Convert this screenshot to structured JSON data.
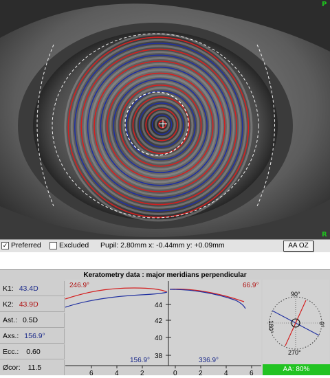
{
  "eye_view": {
    "corner_top_right": "P",
    "corner_bottom_right": "R"
  },
  "toolbar": {
    "preferred_label": "Preferred",
    "preferred_checked": true,
    "excluded_label": "Excluded",
    "excluded_checked": false,
    "pupil_info": "Pupil: 2.80mm x: -0.44mm y: +0.09mm",
    "aa_oz_label": "AA OZ"
  },
  "keratometry": {
    "title": "Keratometry data : major meridians perpendicular",
    "rows": [
      {
        "label": "K1:",
        "value": "43.4D",
        "color": "#1b2a8a"
      },
      {
        "label": "K2:",
        "value": "43.9D",
        "color": "#b01010"
      },
      {
        "label": "Ast.:",
        "value": "0.5D",
        "color": "#000000"
      },
      {
        "label": "Axs.:",
        "value": "156.9°",
        "color": "#1b2a8a"
      },
      {
        "label": "Ecc.:",
        "value": "0.60",
        "color": "#000000"
      },
      {
        "label": "Øcor:",
        "value": "11.5",
        "color": "#000000"
      }
    ],
    "graph": {
      "left_red_axis": "246.9°",
      "right_red_axis": "66.9°",
      "left_blue_axis": "156.9°",
      "right_blue_axis": "336.9°",
      "y_ticks": [
        "44",
        "42",
        "40",
        "38"
      ],
      "x_ticks_left": [
        "6",
        "4",
        "2"
      ],
      "x_ticks_right": [
        "0",
        "2",
        "4",
        "6"
      ]
    },
    "polar": {
      "top": "90°",
      "bottom": "270°",
      "left": "180°",
      "right": "0°"
    },
    "aa_status": "AA: 80%"
  },
  "colors": {
    "red_curve": "#d42020",
    "blue_curve": "#2030a0",
    "status_green": "#22c322"
  }
}
